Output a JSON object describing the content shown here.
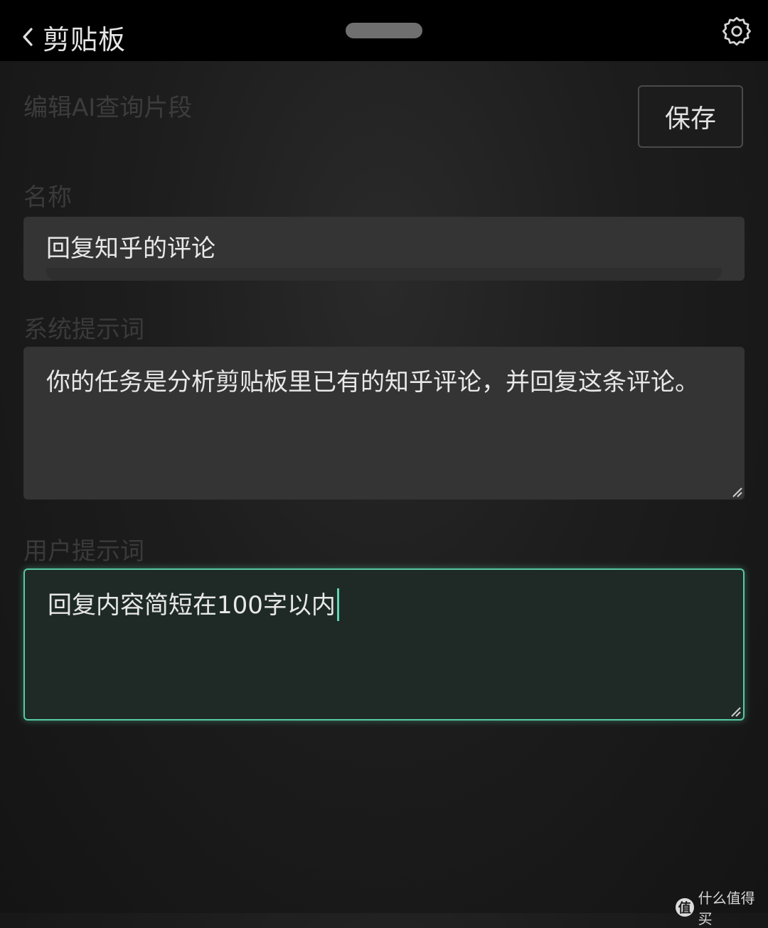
{
  "header": {
    "back_label": "剪贴板",
    "back_icon": "chevron-left-icon",
    "settings_icon": "gear-icon"
  },
  "editor": {
    "title": "编辑AI查询片段",
    "save_label": "保存",
    "name": {
      "label": "名称",
      "value": "回复知乎的评论"
    },
    "system_prompt": {
      "label": "系统提示词",
      "value": "你的任务是分析剪贴板里已有的知乎评论，并回复这条评论。"
    },
    "user_prompt": {
      "label": "用户提示词",
      "value": "回复内容简短在100字以内"
    }
  },
  "watermark": {
    "badge": "值",
    "text": "什么值得买"
  },
  "colors": {
    "accent": "#58c9a3",
    "background": "#1d1d1d",
    "topbar": "#000000",
    "field": "#343434"
  }
}
